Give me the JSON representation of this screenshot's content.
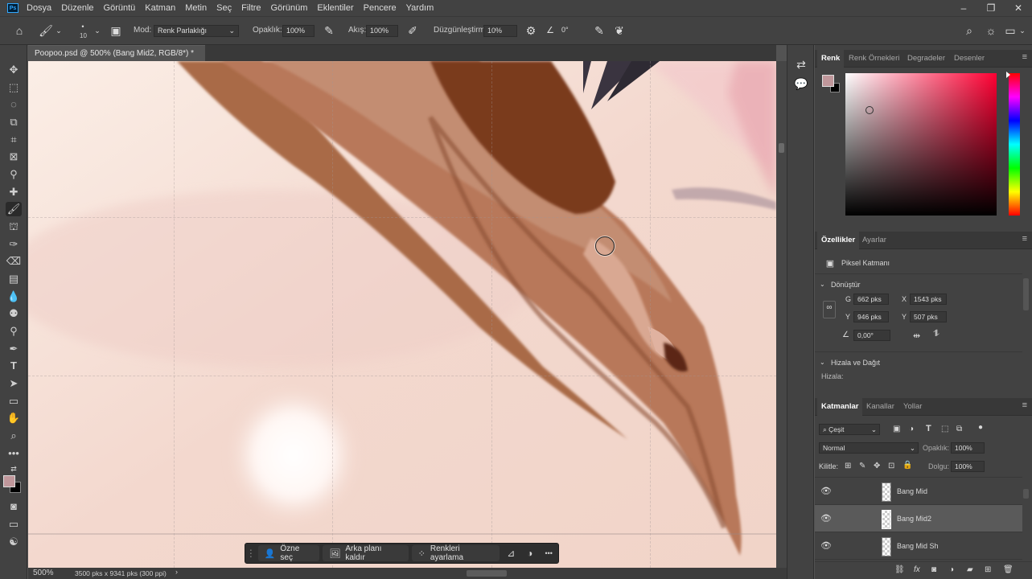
{
  "app": {
    "logo": "Ps",
    "doc_tab": "Poopoo.psd @ 500% (Bang Mid2, RGB/8*) *",
    "doc_tab_close": "×"
  },
  "menu": [
    "Dosya",
    "Düzenle",
    "Görüntü",
    "Katman",
    "Metin",
    "Seç",
    "Filtre",
    "Görünüm",
    "Eklentiler",
    "Pencere",
    "Yardım"
  ],
  "window_controls": [
    "–",
    "❐",
    "✕"
  ],
  "options": {
    "brush_size": "10",
    "mode_label": "Mod:",
    "mode_value": "Renk Parlaklığı",
    "opacity_label": "Opaklık:",
    "opacity_value": "100%",
    "flow_label": "Akış:",
    "flow_value": "100%",
    "smoothing_label": "Düzgünleştirme:",
    "smoothing_value": "10%",
    "angle_value": "0°"
  },
  "status": {
    "zoom": "500%",
    "doc_info": "3500 pks x 9341 pks (300 ppi)",
    "arrow": "›"
  },
  "context_bar": {
    "select_subject": "Özne seç",
    "remove_bg": "Arka planı kaldır",
    "adjust_colors": "Renkleri ayarlama",
    "more": "•••"
  },
  "color_panel": {
    "tabs": [
      "Renk",
      "Renk Örnekleri",
      "Degradeler",
      "Desenler"
    ],
    "foreground": "#c0979b",
    "background": "#000000",
    "hue": "#ff0033"
  },
  "properties": {
    "tabs": [
      "Özellikler",
      "Ayarlar"
    ],
    "type": "Piksel Katmanı",
    "transform_title": "Dönüştür",
    "w_label": "G",
    "w_value": "662 pks",
    "x_label": "X",
    "x_value": "1543 pks",
    "h_label": "Y",
    "h_value": "946 pks",
    "y_label": "Y",
    "y_value": "507 pks",
    "angle_value": "0,00°",
    "align_title": "Hizala ve Dağıt",
    "align_label": "Hizala:"
  },
  "layers_panel": {
    "tabs": [
      "Katmanlar",
      "Kanallar",
      "Yollar"
    ],
    "filter_kind": "Çeşit",
    "blend_mode": "Normal",
    "opacity_label": "Opaklık:",
    "opacity_value": "100%",
    "lock_label": "Kilitle:",
    "fill_label": "Dolgu:",
    "fill_value": "100%",
    "layers": [
      {
        "name": "Bang Mid",
        "visible": true,
        "selected": false
      },
      {
        "name": "Bang Mid2",
        "visible": true,
        "selected": true
      },
      {
        "name": "Bang Mid Sh",
        "visible": true,
        "selected": false
      }
    ],
    "bottom_icons": [
      "link-icon",
      "fx-icon",
      "mask-icon",
      "adjustment-icon",
      "folder-icon",
      "new-layer-icon",
      "trash-icon"
    ]
  }
}
